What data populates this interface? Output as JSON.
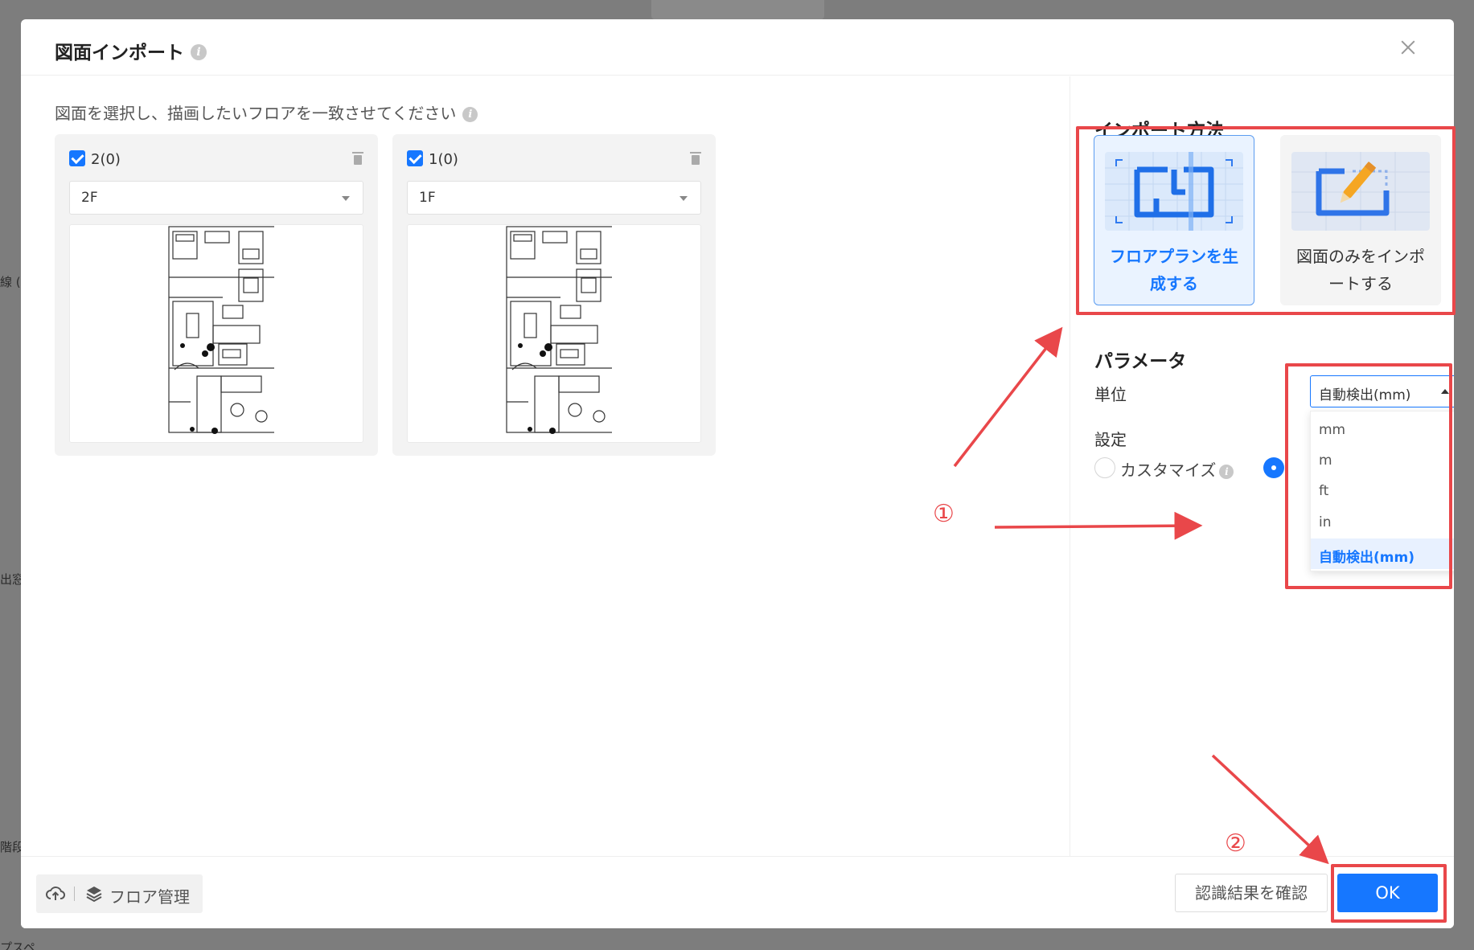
{
  "background": {
    "left_labels": [
      "線 (H",
      "出窓",
      "階段",
      "プスペ"
    ]
  },
  "dialog": {
    "title": "図面インポート",
    "instruction": "図面を選択し、描画したいフロアを一致させてください",
    "floors": [
      {
        "label": "2(0)",
        "checked": true,
        "floor_value": "2F"
      },
      {
        "label": "1(0)",
        "checked": true,
        "floor_value": "1F"
      }
    ],
    "import_method": {
      "title": "インポート方法",
      "options": [
        {
          "label": "フロアプランを生成する",
          "line1": "フロアプランを生",
          "line2": "成する",
          "selected": true
        },
        {
          "label": "図面のみをインポートする",
          "line1": "図面のみをインポ",
          "line2": "ートする",
          "selected": false
        }
      ]
    },
    "parameters": {
      "title": "パラメータ",
      "unit_label": "単位",
      "unit_value": "自動検出(mm)",
      "unit_options": [
        "mm",
        "m",
        "ft",
        "in",
        "自動検出(mm)"
      ],
      "settings_label": "設定",
      "custom_option": "カスタマイズ"
    },
    "footer": {
      "floor_manage": "フロア管理",
      "confirm_button": "認識結果を確認",
      "ok_button": "OK"
    }
  },
  "annotations": {
    "step1": "①",
    "step2": "②"
  },
  "colors": {
    "accent": "#1677ff",
    "annotation": "#e9474a"
  }
}
